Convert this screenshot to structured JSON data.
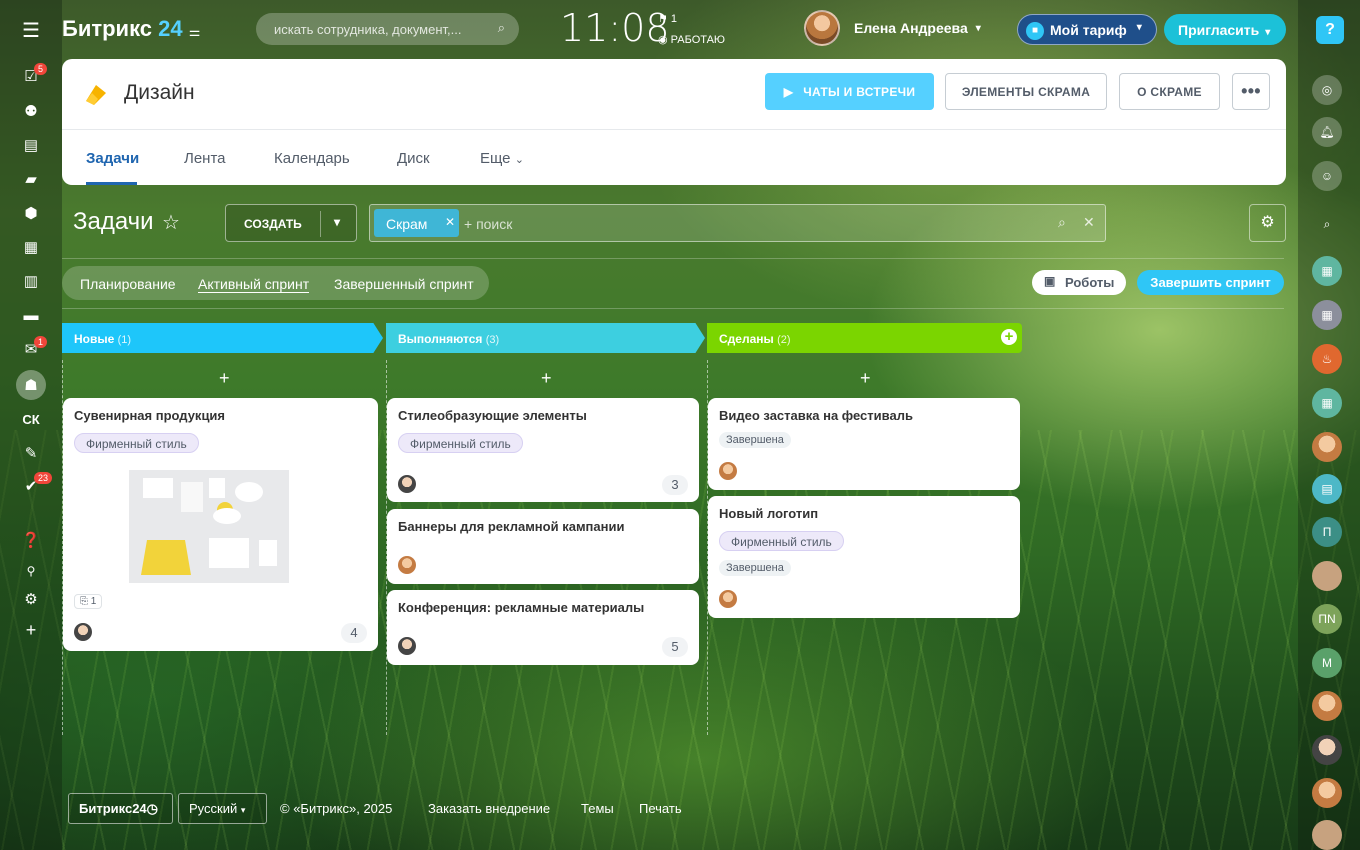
{
  "header": {
    "logo_main": "Битрикс",
    "logo_num": "24",
    "search_placeholder": "искать сотрудника, документ,...",
    "clock": "11:08",
    "flag_count": "1",
    "work_status": "РАБОТАЮ",
    "user_name": "Елена Андреева",
    "tariff": "Мой тариф",
    "invite": "Пригласить",
    "help": "?"
  },
  "left_sidebar": {
    "badges": [
      "5",
      "1",
      "23"
    ],
    "initials": "СК"
  },
  "right_sidebar": {
    "initials": [
      "П",
      "ПN",
      "М"
    ]
  },
  "project": {
    "name": "Дизайн",
    "buttons": [
      "ЧАТЫ И ВСТРЕЧИ",
      "ЭЛЕМЕНТЫ СКРАМА",
      "О СКРАМЕ",
      "•••"
    ],
    "tabs": [
      "Задачи",
      "Лента",
      "Календарь",
      "Диск",
      "Еще"
    ]
  },
  "tasks": {
    "title": "Задачи",
    "create": "СОЗДАТЬ",
    "filter_chip": "Скрам",
    "filter_placeholder": "+ поиск",
    "sprint_tabs": [
      "Планирование",
      "Активный спринт",
      "Завершенный спринт"
    ],
    "robots": "Роботы",
    "finish_sprint": "Завершить спринт"
  },
  "columns": [
    {
      "name": "Новые",
      "count": "(1)",
      "color": "#1ec6fa"
    },
    {
      "name": "Выполняются",
      "count": "(3)",
      "color": "#3dcfe0"
    },
    {
      "name": "Сделаны",
      "count": "(2)",
      "color": "#7bd500"
    }
  ],
  "cards": {
    "c1": {
      "title": "Сувенирная продукция",
      "tag": "Фирменный стиль",
      "attach": "1",
      "count": "4"
    },
    "c2": {
      "title": "Стилеобразующие элементы",
      "tag": "Фирменный стиль",
      "count": "3"
    },
    "c3": {
      "title": "Баннеры для рекламной кампании"
    },
    "c4": {
      "title": "Конференция: рекламные материалы",
      "count": "5"
    },
    "c5": {
      "title": "Видео заставка на фестиваль",
      "status": "Завершена"
    },
    "c6": {
      "title": "Новый логотип",
      "tag": "Фирменный стиль",
      "status": "Завершена"
    }
  },
  "footer": {
    "logo": "Битрикс24",
    "lang": "Русский",
    "copyright": "© «Битрикс», 2025",
    "links": [
      "Заказать внедрение",
      "Темы",
      "Печать"
    ]
  }
}
